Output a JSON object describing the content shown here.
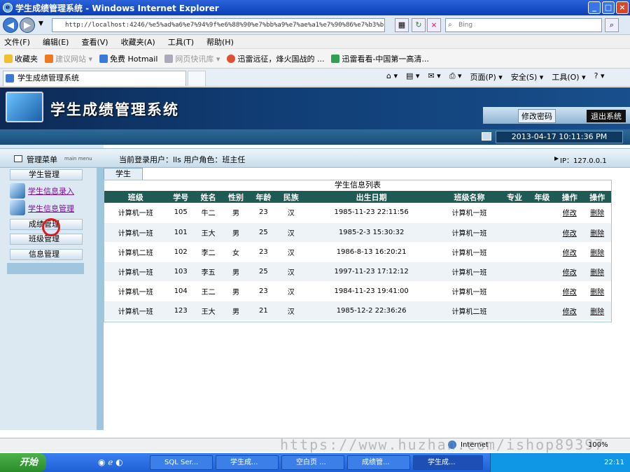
{
  "window": {
    "title": "学生成绩管理系统 - Windows Internet Explorer"
  },
  "address": {
    "url": "http://localhost:4246/%e5%ad%a6%e7%94%9f%e6%88%90%e7%bb%a9%e7%ae%a1%e7%90%86%e7%b3%bb",
    "search_placeholder": "Bing"
  },
  "menubar": [
    "文件(F)",
    "编辑(E)",
    "查看(V)",
    "收藏夹(A)",
    "工具(T)",
    "帮助(H)"
  ],
  "favorites": {
    "label": "收藏夹",
    "items": [
      "建议网站 ▾",
      "免费 Hotmail",
      "网页快讯库 ▾",
      "迅雷远征，烽火国战的 ...",
      "迅雷看看-中国第一高清..."
    ]
  },
  "tab": {
    "title": "学生成绩管理系统"
  },
  "commands": [
    "页面(P) ▾",
    "安全(S) ▾",
    "工具(O) ▾"
  ],
  "banner": {
    "system_name": "学生成绩管理系统",
    "change_password": "修改密码",
    "logout": "退出系统",
    "datetime": "2013-04-17 10:11:36 PM"
  },
  "userbar": {
    "menu_label": "管理菜单",
    "menu_sub": "main menu",
    "current_user": "当前登录用户：lls 用户角色：班主任",
    "ip": "IP：127.0.0.1"
  },
  "sidemenu": {
    "student_mgmt": "学生管理",
    "student_entry": "学生信息录入",
    "student_info": "学生信息管理",
    "score_mgmt": "成绩管理",
    "class_mgmt": "班级管理",
    "info_mgmt": "信息管理"
  },
  "content": {
    "tab_label": "学生",
    "list_title": "学生信息列表",
    "columns": [
      "班级",
      "学号",
      "姓名",
      "性别",
      "年龄",
      "民族",
      "出生日期",
      "班级名称",
      "专业",
      "年级",
      "操作",
      "操作"
    ],
    "rows": [
      [
        "计算机一班",
        "105",
        "牛二",
        "男",
        "23",
        "汉",
        "1985-11-23 22:11:56",
        "计算机一班",
        "",
        "",
        "修改",
        "删除"
      ],
      [
        "计算机一班",
        "101",
        "王大",
        "男",
        "25",
        "汉",
        "1985-2-3 15:30:32",
        "计算机一班",
        "",
        "",
        "修改",
        "删除"
      ],
      [
        "计算机二班",
        "102",
        "李二",
        "女",
        "23",
        "汉",
        "1986-8-13 16:20:21",
        "计算机一班",
        "",
        "",
        "修改",
        "删除"
      ],
      [
        "计算机一班",
        "103",
        "李五",
        "男",
        "25",
        "汉",
        "1997-11-23 17:12:12",
        "计算机一班",
        "",
        "",
        "修改",
        "删除"
      ],
      [
        "计算机一班",
        "104",
        "王二",
        "男",
        "23",
        "汉",
        "1984-11-23 19:41:00",
        "计算机一班",
        "",
        "",
        "修改",
        "删除"
      ],
      [
        "计算机一班",
        "123",
        "王大",
        "男",
        "21",
        "汉",
        "1985-12-2 22:36:26",
        "计算机二班",
        "",
        "",
        "修改",
        "删除"
      ]
    ]
  },
  "statusbar": {
    "zone": "Internet",
    "zoom": "100%"
  },
  "watermark": "https://www.huzhan.com/ishop89397",
  "taskbar": {
    "start": "开始",
    "tasks": [
      "SQL Ser...",
      "学生成...",
      "空白页 ...",
      "成绩管...",
      "学生成..."
    ],
    "clock": "22:11"
  },
  "colors": {
    "header_dark": "#1f5a55",
    "banner": "#103c73",
    "link": "#7a0e9e"
  }
}
